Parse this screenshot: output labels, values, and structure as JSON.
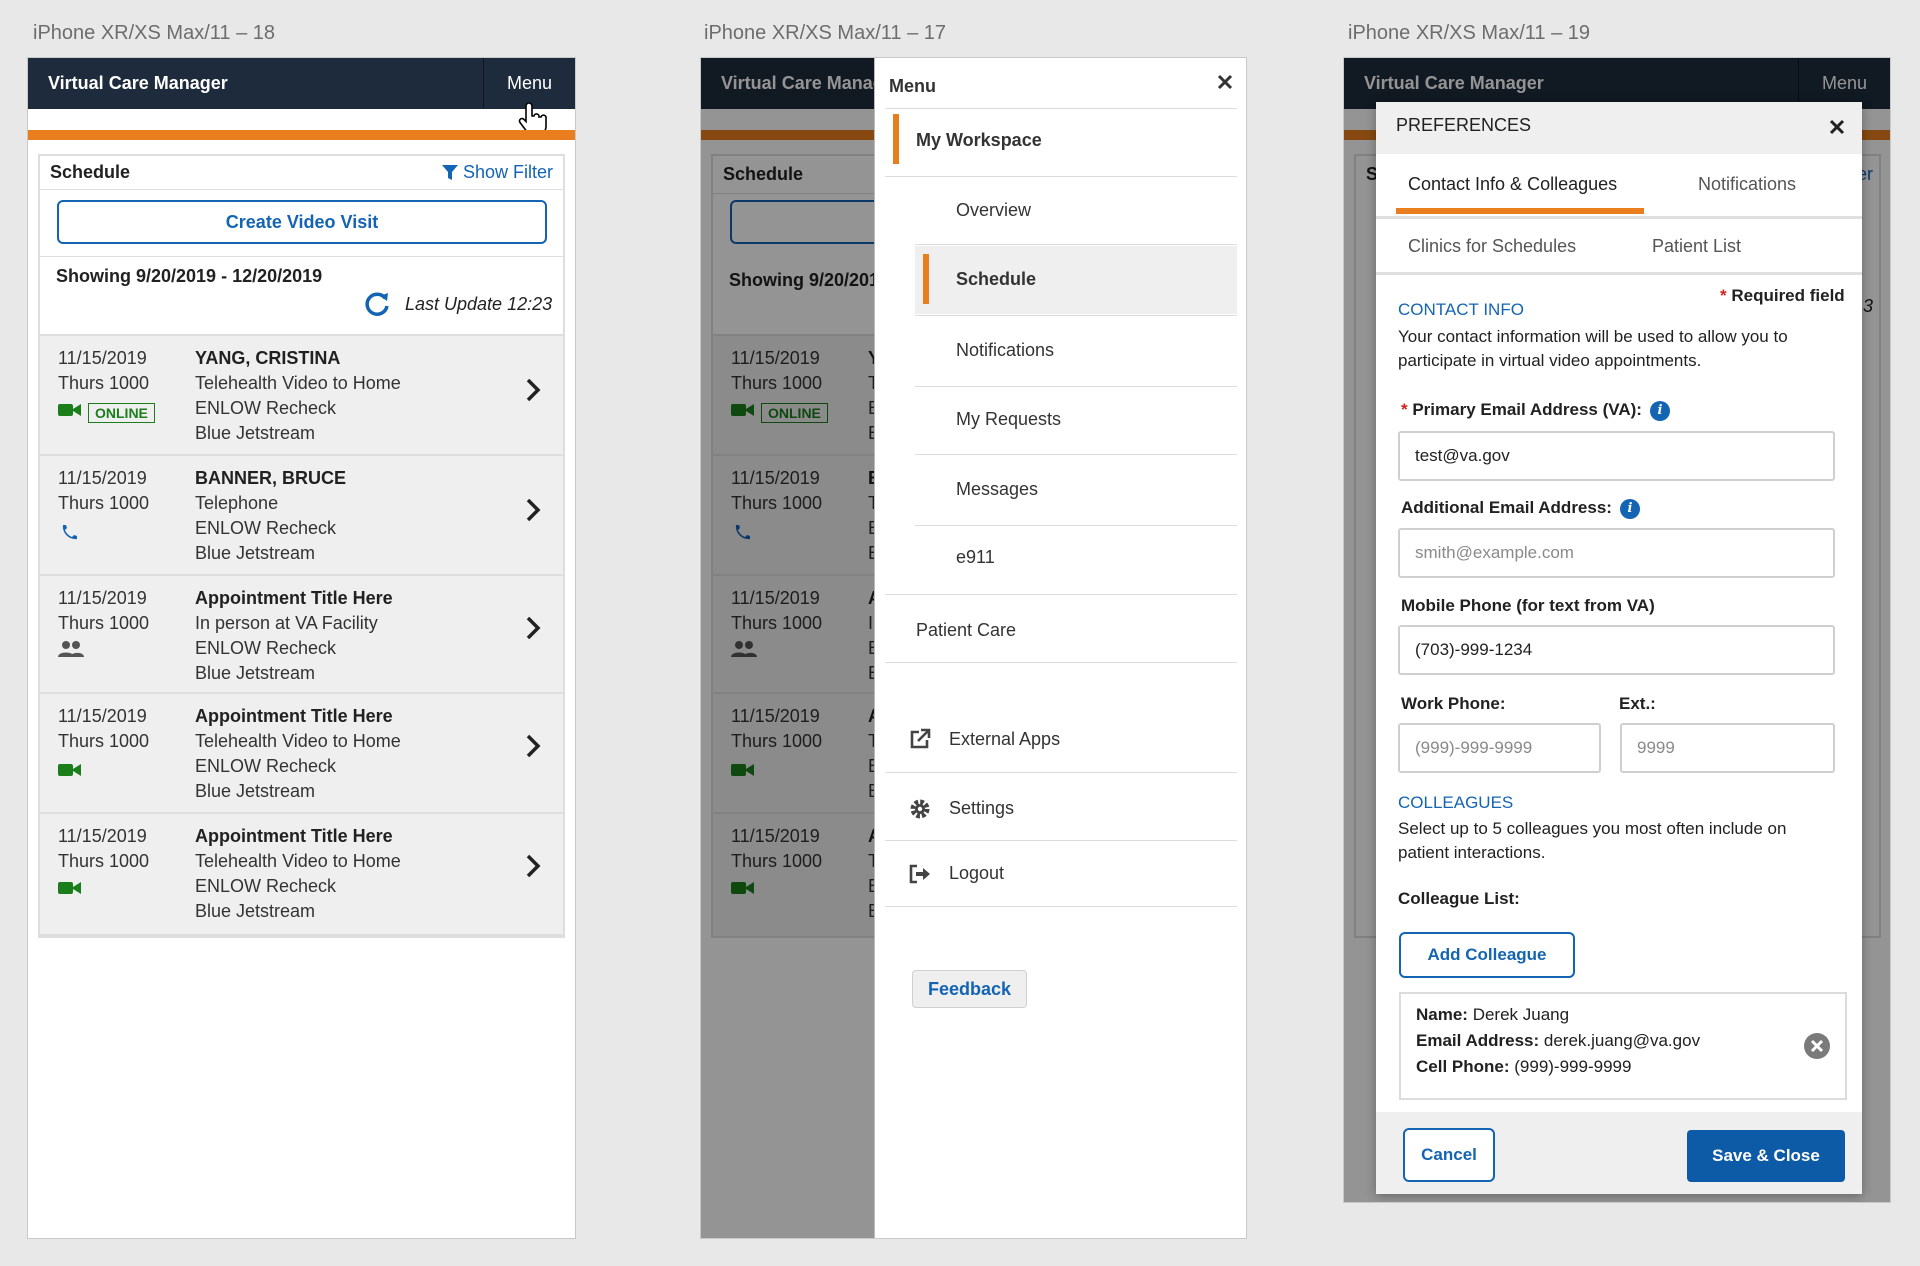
{
  "frames": [
    {
      "title": "iPhone XR/XS Max/11 – 18"
    },
    {
      "title": "iPhone XR/XS Max/11 – 17"
    },
    {
      "title": "iPhone XR/XS Max/11 – 19"
    }
  ],
  "header": {
    "app_title": "Virtual Care Manager",
    "app_title_clipped": "Virtual Care Manag",
    "menu_label": "Menu"
  },
  "schedule": {
    "title": "Schedule",
    "show_filter": "Show Filter",
    "create_button": "Create Video Visit",
    "range": "Showing 9/20/2019 - 12/20/2019",
    "range_clipped": "Showing 9/20/201",
    "last_update": "Last Update 12:23",
    "online_badge": "ONLINE",
    "appointments": [
      {
        "date": "11/15/2019",
        "time": "Thurs 1000",
        "title": "YANG, CRISTINA",
        "type": "Telehealth Video to Home",
        "clinic": "ENLOW Recheck",
        "room": "Blue Jetstream",
        "icon": "video-icon",
        "online": true,
        "initial": "Y",
        "line2": "T",
        "line3": "E",
        "line4": "B"
      },
      {
        "date": "11/15/2019",
        "time": "Thurs 1000",
        "title": "BANNER, BRUCE",
        "type": "Telephone",
        "clinic": "ENLOW Recheck",
        "room": "Blue Jetstream",
        "icon": "phone-icon",
        "online": false,
        "initial": "B",
        "line2": "T",
        "line3": "E",
        "line4": "B"
      },
      {
        "date": "11/15/2019",
        "time": "Thurs 1000",
        "title": "Appointment Title Here",
        "type": "In person at VA Facility",
        "clinic": "ENLOW Recheck",
        "room": "Blue Jetstream",
        "icon": "people-icon",
        "online": false,
        "initial": "A",
        "line2": "I",
        "line3": "E",
        "line4": "B"
      },
      {
        "date": "11/15/2019",
        "time": "Thurs 1000",
        "title": "Appointment Title Here",
        "type": "Telehealth Video to Home",
        "clinic": "ENLOW Recheck",
        "room": "Blue Jetstream",
        "icon": "video-icon",
        "online": false,
        "initial": "A",
        "line2": "T",
        "line3": "E",
        "line4": "B"
      },
      {
        "date": "11/15/2019",
        "time": "Thurs 1000",
        "title": "Appointment Title Here",
        "type": "Telehealth Video to Home",
        "clinic": "ENLOW Recheck",
        "room": "Blue Jetstream",
        "icon": "video-icon",
        "online": false,
        "initial": "A",
        "line2": "T",
        "line3": "E",
        "line4": "B"
      }
    ]
  },
  "menu": {
    "title": "Menu",
    "workspace": "My Workspace",
    "items": [
      "Overview",
      "Schedule",
      "Notifications",
      "My Requests",
      "Messages",
      "e911"
    ],
    "patient_care": "Patient Care",
    "external_apps": "External Apps",
    "settings": "Settings",
    "logout": "Logout",
    "feedback": "Feedback"
  },
  "preferences": {
    "title": "PREFERENCES",
    "tabs": [
      "Contact Info & Colleagues",
      "Notifications",
      "Clinics for Schedules",
      "Patient List"
    ],
    "required_note": "Required field",
    "contact_heading": "CONTACT INFO",
    "contact_text_1": "Your contact information will be used to allow you to",
    "contact_text_2": "participate in virtual video appointments.",
    "primary_email_label": "Primary Email Address (VA):",
    "primary_email_value": "test@va.gov",
    "additional_email_label": "Additional Email Address:",
    "additional_email_placeholder": "smith@example.com",
    "mobile_label": "Mobile Phone (for text from VA)",
    "mobile_value": "(703)-999-1234",
    "work_label": "Work Phone:",
    "work_placeholder": "(999)-999-9999",
    "ext_label": "Ext.:",
    "ext_placeholder": "9999",
    "colleagues_heading": "COLLEAGUES",
    "colleagues_text_1": "Select up to 5 colleagues you most often include on",
    "colleagues_text_2": "patient interactions.",
    "colleague_list_label": "Colleague List:",
    "add_colleague": "Add Colleague",
    "colleague": {
      "name_label": "Name:",
      "name": "Derek Juang",
      "email_label": "Email Address:",
      "email": "derek.juang@va.gov",
      "phone_label": "Cell Phone:",
      "phone": "(999)-999-9999"
    },
    "cancel": "Cancel",
    "save": "Save & Close",
    "bg_filter_clipped": "er",
    "bg_s": "S",
    "bg_3": "3"
  },
  "colors": {
    "navy": "#1e2b3c",
    "orange": "#e87e1e",
    "blue": "#1464b4",
    "green": "#1b7e1b",
    "required": "#d62020"
  }
}
